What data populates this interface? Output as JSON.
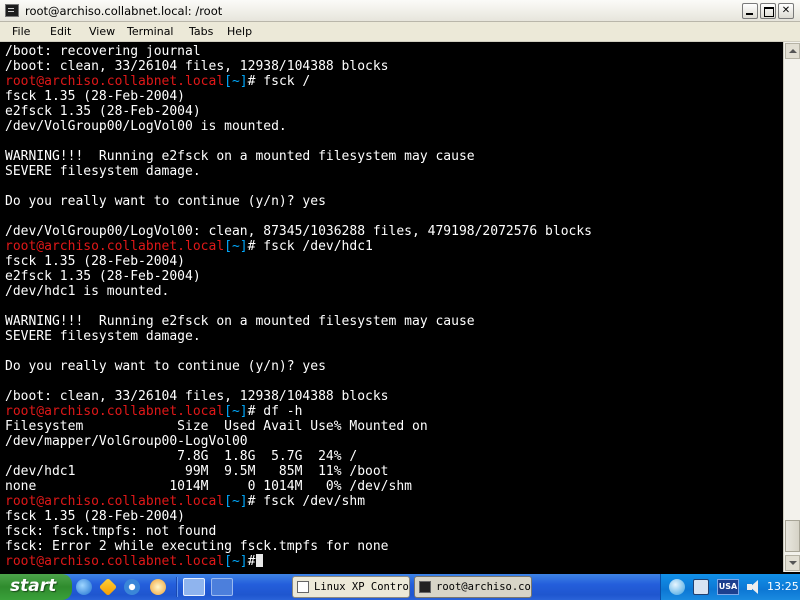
{
  "window": {
    "title": "root@archiso.collabnet.local: /root"
  },
  "menu": [
    "File",
    "Edit",
    "View",
    "Terminal",
    "Tabs",
    "Help"
  ],
  "prompt": {
    "user_host": "root@archiso.collabnet.local",
    "cwd": "[~]",
    "symbol": "#"
  },
  "terminal_lines": [
    {
      "text": "/boot: recovering journal"
    },
    {
      "text": "/boot: clean, 33/26104 files, 12938/104388 blocks"
    },
    {
      "prompt": true,
      "cmd": " fsck /"
    },
    {
      "text": "fsck 1.35 (28-Feb-2004)"
    },
    {
      "text": "e2fsck 1.35 (28-Feb-2004)"
    },
    {
      "text": "/dev/VolGroup00/LogVol00 is mounted."
    },
    {
      "text": ""
    },
    {
      "text": "WARNING!!!  Running e2fsck on a mounted filesystem may cause"
    },
    {
      "text": "SEVERE filesystem damage."
    },
    {
      "text": ""
    },
    {
      "text": "Do you really want to continue (y/n)? yes"
    },
    {
      "text": ""
    },
    {
      "text": "/dev/VolGroup00/LogVol00: clean, 87345/1036288 files, 479198/2072576 blocks"
    },
    {
      "prompt": true,
      "cmd": " fsck /dev/hdc1"
    },
    {
      "text": "fsck 1.35 (28-Feb-2004)"
    },
    {
      "text": "e2fsck 1.35 (28-Feb-2004)"
    },
    {
      "text": "/dev/hdc1 is mounted."
    },
    {
      "text": ""
    },
    {
      "text": "WARNING!!!  Running e2fsck on a mounted filesystem may cause"
    },
    {
      "text": "SEVERE filesystem damage."
    },
    {
      "text": ""
    },
    {
      "text": "Do you really want to continue (y/n)? yes"
    },
    {
      "text": ""
    },
    {
      "text": "/boot: clean, 33/26104 files, 12938/104388 blocks"
    },
    {
      "prompt": true,
      "cmd": " df -h"
    },
    {
      "text": "Filesystem            Size  Used Avail Use% Mounted on"
    },
    {
      "text": "/dev/mapper/VolGroup00-LogVol00"
    },
    {
      "text": "                      7.8G  1.8G  5.7G  24% /"
    },
    {
      "text": "/dev/hdc1              99M  9.5M   85M  11% /boot"
    },
    {
      "text": "none                 1014M     0 1014M   0% /dev/shm"
    },
    {
      "prompt": true,
      "cmd": " fsck /dev/shm"
    },
    {
      "text": "fsck 1.35 (28-Feb-2004)"
    },
    {
      "text": "fsck: fsck.tmpfs: not found"
    },
    {
      "text": "fsck: Error 2 while executing fsck.tmpfs for none"
    },
    {
      "prompt": true,
      "cmd": "",
      "cursor": true
    }
  ],
  "taskbar": {
    "start_label": "start",
    "tasks": [
      {
        "label": "Linux XP Control"
      },
      {
        "label": "root@archiso.col"
      }
    ],
    "tray": {
      "language": "USA",
      "clock": "13:25"
    }
  },
  "colors": {
    "prompt_user": "#e01818",
    "prompt_cwd": "#00aaff",
    "terminal_bg": "#000000",
    "terminal_fg": "#ffffff",
    "taskbar_blue": "#245edb",
    "start_green": "#2f8b2d"
  }
}
